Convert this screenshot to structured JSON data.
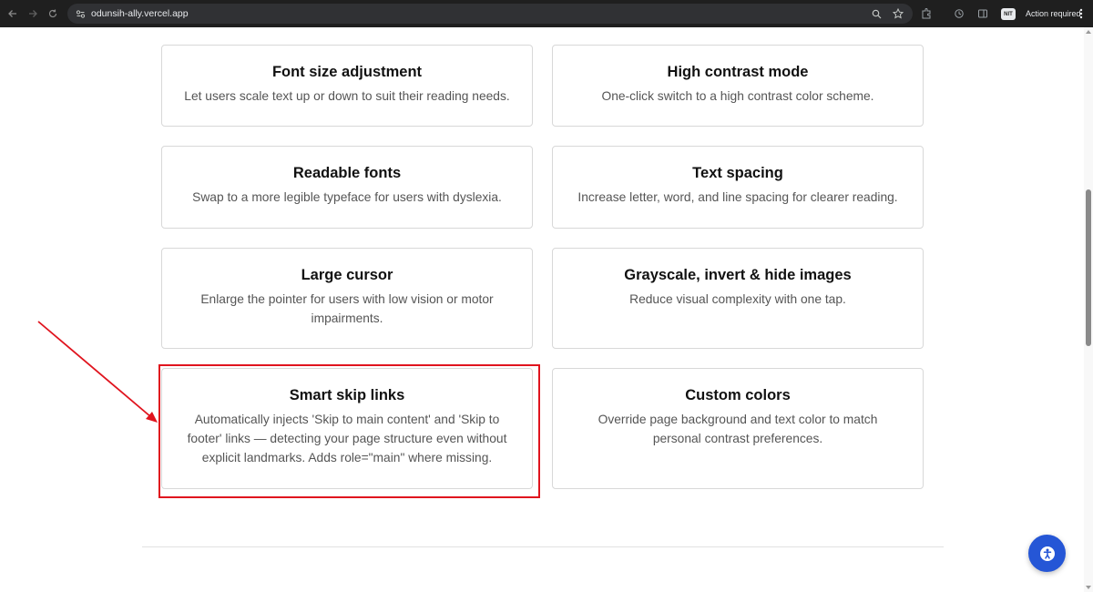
{
  "browser": {
    "url": "odunsih-ally.vercel.app",
    "profile_initials": "NIT",
    "action_label": "Action required"
  },
  "features": [
    {
      "title": "Font size adjustment",
      "description": "Let users scale text up or down to suit their reading needs."
    },
    {
      "title": "High contrast mode",
      "description": "One-click switch to a high contrast color scheme."
    },
    {
      "title": "Readable fonts",
      "description": "Swap to a more legible typeface for users with dyslexia."
    },
    {
      "title": "Text spacing",
      "description": "Increase letter, word, and line spacing for clearer reading."
    },
    {
      "title": "Large cursor",
      "description": "Enlarge the pointer for users with low vision or motor impairments."
    },
    {
      "title": "Grayscale, invert & hide images",
      "description": "Reduce visual complexity with one tap."
    },
    {
      "title": "Smart skip links",
      "description": "Automatically injects 'Skip to main content' and 'Skip to footer' links — detecting your page structure even without explicit landmarks. Adds role=\"main\" where missing."
    },
    {
      "title": "Custom colors",
      "description": "Override page background and text color to match personal contrast preferences."
    }
  ],
  "annotation": {
    "highlight_color": "#e0141e",
    "highlighted_feature": "Smart skip links"
  },
  "colors": {
    "accent": "#2556d6",
    "chrome_bg": "#1f1f1f"
  },
  "icons": {
    "fab": "accessibility-icon"
  }
}
